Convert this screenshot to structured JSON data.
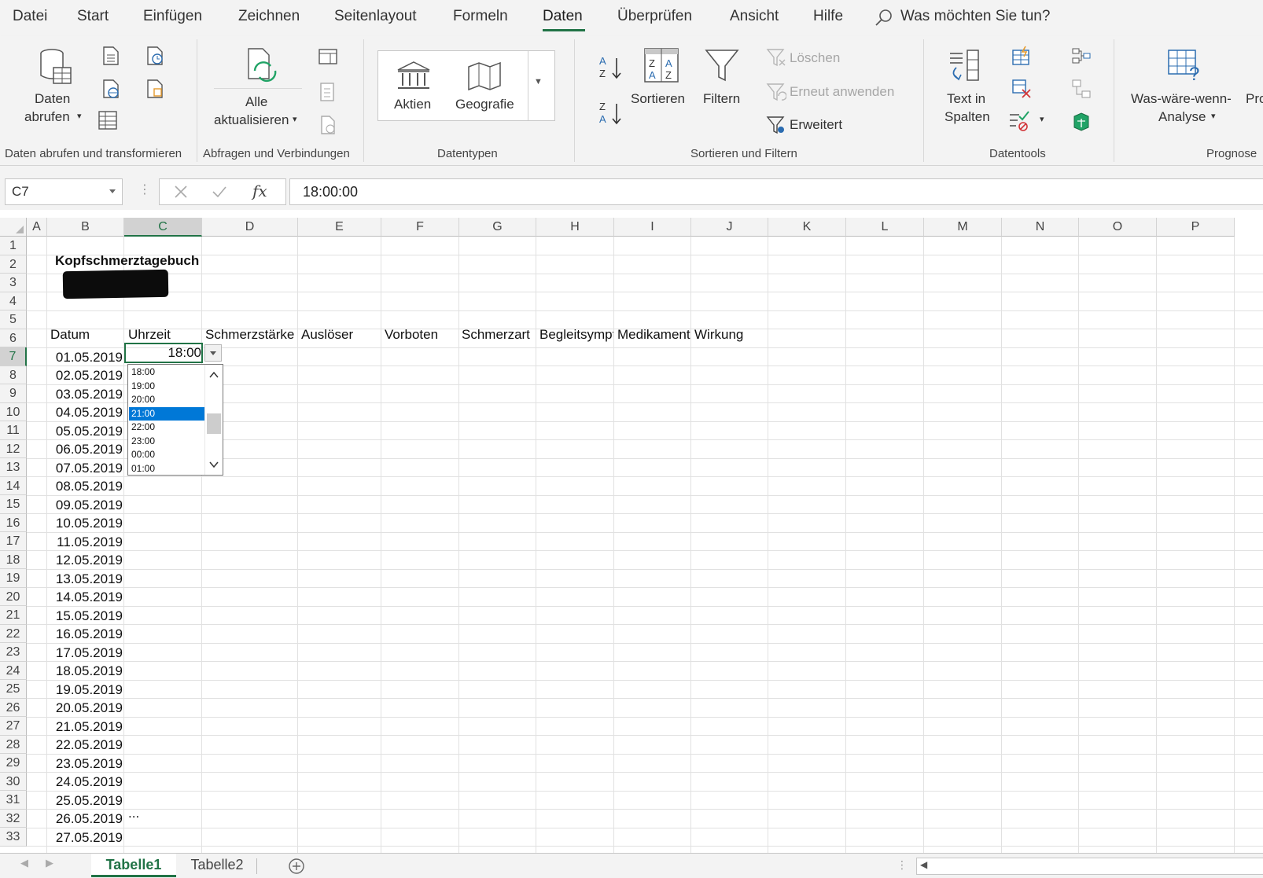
{
  "menu": {
    "tabs": [
      "Datei",
      "Start",
      "Einfügen",
      "Zeichnen",
      "Seitenlayout",
      "Formeln",
      "Daten",
      "Überprüfen",
      "Ansicht",
      "Hilfe"
    ],
    "active_tab": "Daten",
    "tell_me": "Was möchten Sie tun?"
  },
  "ribbon": {
    "get_data": {
      "line1": "Daten",
      "line2": "abrufen"
    },
    "refresh_all": {
      "line1": "Alle",
      "line2": "aktualisieren"
    },
    "stocks": "Aktien",
    "geography": "Geografie",
    "sort": "Sortieren",
    "filter": "Filtern",
    "clear": "Löschen",
    "reapply": "Erneut anwenden",
    "advanced": "Erweitert",
    "text_to_columns": {
      "line1": "Text in",
      "line2": "Spalten"
    },
    "what_if": {
      "line1": "Was-wäre-wenn-",
      "line2": "Analyse"
    },
    "forecast_partial": "Pro",
    "groups": {
      "get_transform": "Daten abrufen und transformieren",
      "queries": "Abfragen und Verbindungen",
      "data_types": "Datentypen",
      "sort_filter": "Sortieren und Filtern",
      "data_tools": "Datentools",
      "forecast": "Prognose"
    }
  },
  "formula_bar": {
    "name_box": "C7",
    "formula": "18:00:00"
  },
  "columns": [
    "A",
    "B",
    "C",
    "D",
    "E",
    "F",
    "G",
    "H",
    "I",
    "J",
    "K",
    "L",
    "M",
    "N",
    "O",
    "P"
  ],
  "selected_column": "C",
  "rows": [
    "1",
    "2",
    "3",
    "4",
    "5",
    "6",
    "7",
    "8",
    "9",
    "10",
    "11",
    "12",
    "13",
    "14",
    "15",
    "16",
    "17",
    "18",
    "19",
    "20",
    "21",
    "22",
    "23",
    "24",
    "25",
    "26",
    "27",
    "28",
    "29",
    "30",
    "31",
    "32",
    "33"
  ],
  "selected_row": "7",
  "sheet": {
    "title": "Kopfschmerztagebuch",
    "headers": [
      "Datum",
      "Uhrzeit",
      "Schmerzstärke",
      "Auslöser",
      "Vorboten",
      "Schmerzart",
      "Begleitsympt",
      "Medikament",
      "Wirkung"
    ],
    "dates": [
      "01.05.2019",
      "02.05.2019",
      "03.05.2019",
      "04.05.2019",
      "05.05.2019",
      "06.05.2019",
      "07.05.2019",
      "08.05.2019",
      "09.05.2019",
      "10.05.2019",
      "11.05.2019",
      "12.05.2019",
      "13.05.2019",
      "14.05.2019",
      "15.05.2019",
      "16.05.2019",
      "17.05.2019",
      "18.05.2019",
      "19.05.2019",
      "20.05.2019",
      "21.05.2019",
      "22.05.2019",
      "23.05.2019",
      "24.05.2019",
      "25.05.2019",
      "26.05.2019",
      "27.05.2019"
    ],
    "c7_value": "18:00",
    "c32_value": "..."
  },
  "dropdown": {
    "options": [
      "18:00",
      "19:00",
      "20:00",
      "21:00",
      "22:00",
      "23:00",
      "00:00",
      "01:00"
    ],
    "selected": "21:00"
  },
  "sheet_tabs": [
    "Tabelle1",
    "Tabelle2"
  ],
  "active_sheet": "Tabelle1",
  "colors": {
    "accent": "#217346",
    "selection": "#0078d7"
  }
}
